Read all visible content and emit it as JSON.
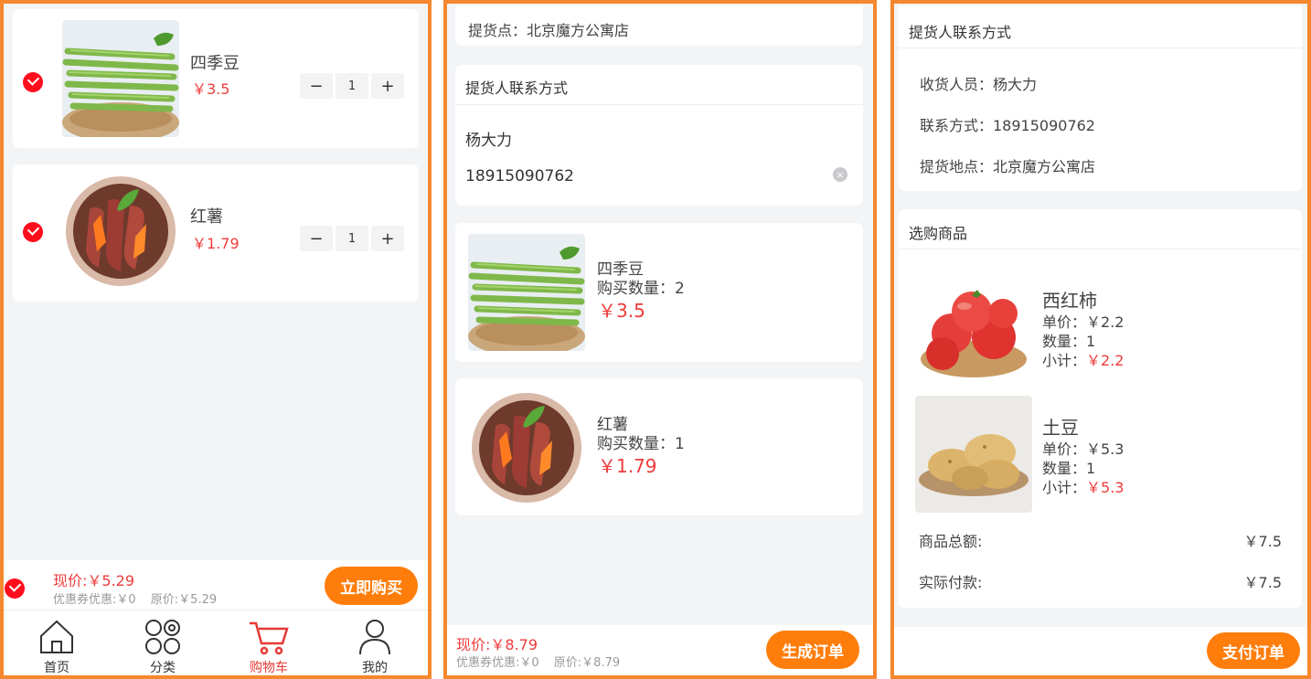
{
  "cart": {
    "items": [
      {
        "name": "四季豆",
        "price": "￥3.5",
        "qty": "1",
        "checked": true,
        "image": "green-beans"
      },
      {
        "name": "红薯",
        "price": "￥1.79",
        "qty": "1",
        "checked": true,
        "image": "sweet-potato"
      }
    ],
    "minus": "−",
    "plus": "+",
    "now_price": "现价:￥5.29",
    "coupon": "优惠券优惠:￥0",
    "original": "原价:￥5.29",
    "buy_button": "立即购买",
    "tabs": [
      {
        "label": "首页",
        "icon": "home-icon"
      },
      {
        "label": "分类",
        "icon": "category-icon"
      },
      {
        "label": "购物车",
        "icon": "cart-icon",
        "active": true
      },
      {
        "label": "我的",
        "icon": "user-icon"
      }
    ]
  },
  "order": {
    "pickup_point": "提货点：北京魔方公寓店",
    "contact_title": "提货人联系方式",
    "contact_name": "杨大力",
    "contact_phone": "18915090762",
    "items": [
      {
        "name": "四季豆",
        "qty_text": "购买数量：2",
        "price": "￥3.5",
        "image": "green-beans"
      },
      {
        "name": "红薯",
        "qty_text": "购买数量：1",
        "price": "￥1.79",
        "image": "sweet-potato"
      }
    ],
    "now_price": "现价:￥8.79",
    "coupon": "优惠券优惠:￥0",
    "original": "原价:￥8.79",
    "submit_button": "生成订单"
  },
  "confirm": {
    "contact_title": "提货人联系方式",
    "receiver": "收货人员：杨大力",
    "phone": "联系方式：18915090762",
    "pickup": "提货地点：北京魔方公寓店",
    "goods_title": "选购商品",
    "items": [
      {
        "name": "西红柿",
        "unit": "单价：￥2.2",
        "qty": "数量：1",
        "subtotal_label": "小计：",
        "subtotal": "￥2.2",
        "image": "tomatoes"
      },
      {
        "name": "土豆",
        "unit": "单价：￥5.3",
        "qty": "数量：1",
        "subtotal_label": "小计：",
        "subtotal": "￥5.3",
        "image": "potatoes"
      }
    ],
    "total_label": "商品总额:",
    "total_value": "￥7.5",
    "paid_label": "实际付款:",
    "paid_value": "￥7.5",
    "pay_button": "支付订单"
  },
  "colors": {
    "accent": "#ff7d0b",
    "price_red": "#ef3b3b",
    "check_red": "#ff0d1d",
    "border": "#f5872f"
  }
}
